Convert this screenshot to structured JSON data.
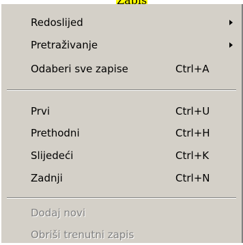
{
  "title": "Zapis",
  "colors": {
    "menu_bg": "#d4d0c8",
    "title_highlight": "#ffff00",
    "disabled_text": "#808080"
  },
  "menu": {
    "items": [
      {
        "label": "Redoslijed",
        "submenu": true
      },
      {
        "label": "Pretraživanje",
        "submenu": true
      },
      {
        "label": "Odaberi sve zapise",
        "shortcut": "Ctrl+A"
      },
      {
        "label": "Prvi",
        "shortcut": "Ctrl+U"
      },
      {
        "label": "Prethodni",
        "shortcut": "Ctrl+H"
      },
      {
        "label": "Slijedeći",
        "shortcut": "Ctrl+K"
      },
      {
        "label": "Zadnji",
        "shortcut": "Ctrl+N"
      },
      {
        "label": "Dodaj novi",
        "disabled": true
      },
      {
        "label": "Obriši trenutni zapis",
        "disabled": true
      }
    ]
  }
}
